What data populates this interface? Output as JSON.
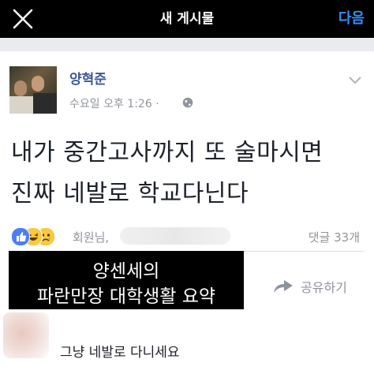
{
  "topbar": {
    "title": "새 게시물",
    "next_label": "다음",
    "close_icon": "close-icon",
    "accent": "#3a8cff"
  },
  "post": {
    "author": "양혁준",
    "meta": "수요일 오후 1:26 · ",
    "privacy_icon": "globe-icon",
    "text_line1": "내가 중간고사까지 또 술마시면",
    "text_line2": "진짜 네발로 학교다닌다"
  },
  "reactions": {
    "icons": [
      "like-icon",
      "haha-icon",
      "sad-icon"
    ],
    "members_label": "회원님,",
    "comments_label": "댓글 33개"
  },
  "overlay": {
    "line1": "양센세의",
    "line2": "파란만장 대학생활 요약"
  },
  "actions": {
    "share_label": "공유하기"
  },
  "comment": {
    "text": "그냥 네발로 다니세요"
  }
}
